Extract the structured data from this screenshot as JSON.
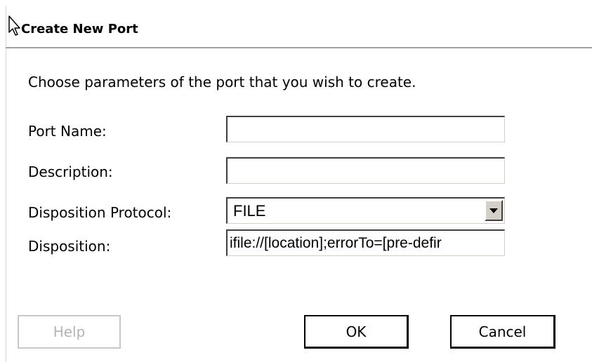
{
  "dialog": {
    "title": "Create New Port",
    "intro": "Choose parameters of the port that you wish to create."
  },
  "form": {
    "port_name": {
      "label": "Port Name:",
      "value": ""
    },
    "description": {
      "label": "Description:",
      "value": ""
    },
    "disposition_protocol": {
      "label": "Disposition Protocol:",
      "selected": "FILE"
    },
    "disposition": {
      "label": "Disposition:",
      "value": "ifile://[location];errorTo=[pre-defir"
    }
  },
  "buttons": {
    "help": "Help",
    "ok": "OK",
    "cancel": "Cancel"
  },
  "icons": {
    "cursor": "mouse-pointer-icon",
    "dropdown": "chevron-down-icon"
  },
  "colors": {
    "title_rule": "#a0a0a0",
    "disabled_text": "#b4b4b4",
    "button_face": "#d4d0c8"
  }
}
